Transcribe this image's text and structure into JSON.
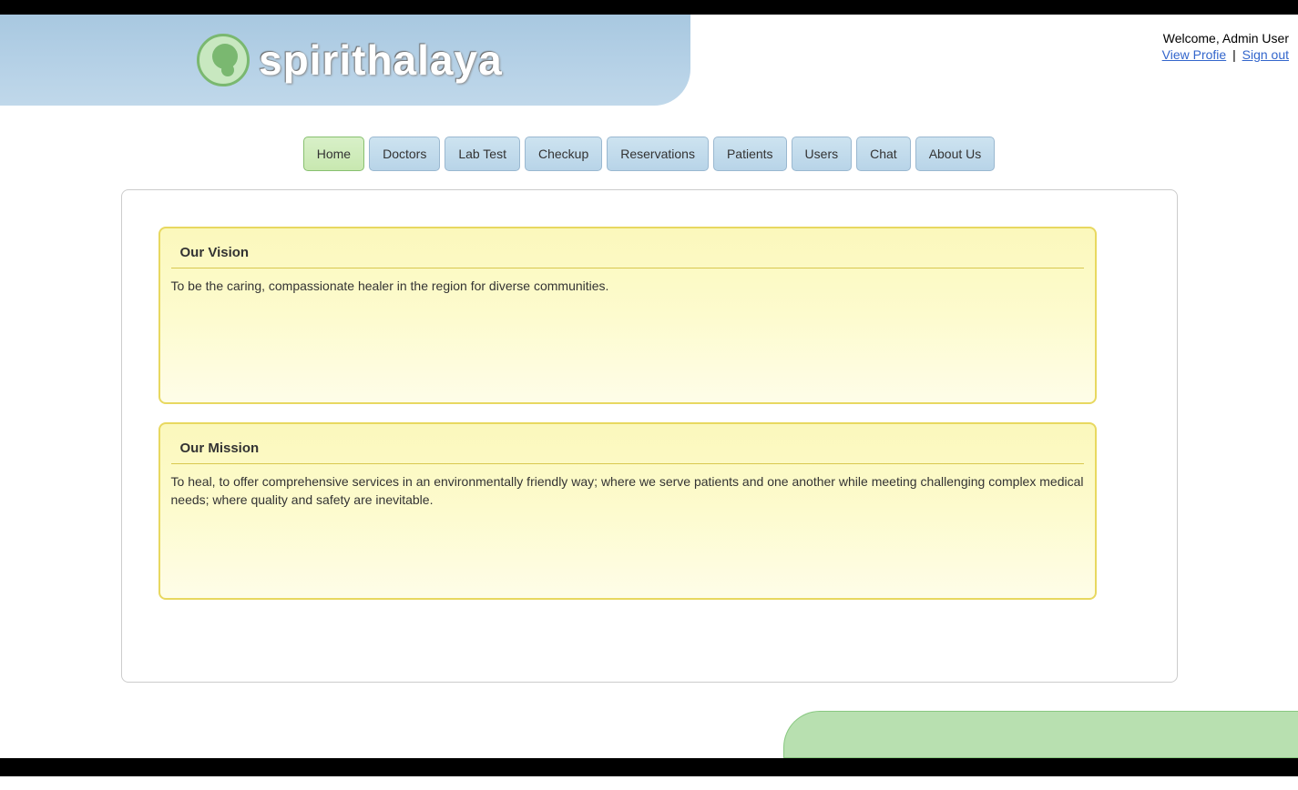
{
  "site_name": "spirithalaya",
  "user": {
    "welcome_prefix": "Welcome, ",
    "username": "Admin User",
    "view_profile": "View Profie",
    "separator": " | ",
    "sign_out": "Sign out"
  },
  "nav": {
    "items": [
      {
        "label": "Home",
        "active": true
      },
      {
        "label": "Doctors",
        "active": false
      },
      {
        "label": "Lab Test",
        "active": false
      },
      {
        "label": "Checkup",
        "active": false
      },
      {
        "label": "Reservations",
        "active": false
      },
      {
        "label": "Patients",
        "active": false
      },
      {
        "label": "Users",
        "active": false
      },
      {
        "label": "Chat",
        "active": false
      },
      {
        "label": "About Us",
        "active": false
      }
    ]
  },
  "cards": {
    "vision": {
      "title": "Our Vision",
      "text": "To be the caring, compassionate healer in the region for diverse communities."
    },
    "mission": {
      "title": "Our Mission",
      "text": "To heal, to offer comprehensive services in an environmentally friendly way; where we serve patients and one another while meeting challenging complex medical needs; where quality and safety are inevitable."
    }
  }
}
